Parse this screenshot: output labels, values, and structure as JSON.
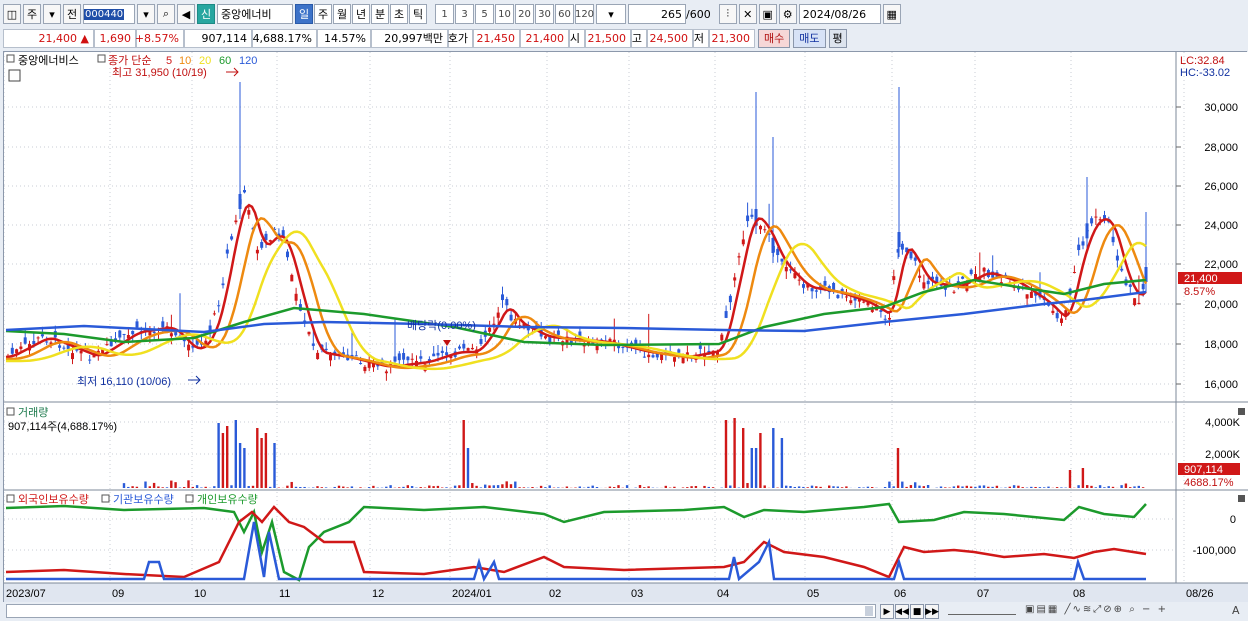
{
  "toolbar": {
    "market_label": "주",
    "prev_label": "전",
    "stock_code": "000440",
    "new_badge": "신",
    "stock_name": "중앙에너비",
    "periods": [
      "일",
      "주",
      "월",
      "년",
      "분",
      "초",
      "틱"
    ],
    "active_period": "일",
    "interval_numbers": [
      "1",
      "3",
      "5",
      "10",
      "20",
      "30",
      "60",
      "120"
    ],
    "count": "265",
    "count_total": "/600",
    "date": "2024/08/26"
  },
  "quote": {
    "price": "21,400",
    "change": "1,690",
    "change_pct": "+8.57%",
    "volume": "907,114",
    "volume_pct": "4,688.17%",
    "turnover": "14.57%",
    "amount": "20,997백만",
    "ask_label": "호가",
    "ask": "21,450",
    "bid": "21,400",
    "open_label": "시",
    "open": "21,500",
    "high_label": "고",
    "high": "24,500",
    "low_label": "저",
    "low": "21,300",
    "buy_label": "매수",
    "sell_label": "매도",
    "avg_label": "평"
  },
  "price_panel": {
    "stock_name": "중앙에너비스",
    "ma_label": "종가 단순",
    "ma_periods": [
      "5",
      "10",
      "20",
      "60",
      "120"
    ],
    "ma_colors": [
      "#d01818",
      "#ee8a10",
      "#f0e020",
      "#1c9a2c",
      "#2a5ad8"
    ],
    "high_note": "최고 31,950 (10/19)",
    "low_note": "최저 16,110 (10/06)",
    "dividend_note": "배당락(0.00%)",
    "lc": "LC:32.84",
    "hc": "HC:-33.02",
    "y_ticks": [
      "30,000",
      "28,000",
      "26,000",
      "24,000",
      "22,000",
      "20,000",
      "18,000",
      "16,000"
    ],
    "last_price": "21,400",
    "last_pct": "8.57%"
  },
  "volume_panel": {
    "title": "거래량",
    "value": "907,114주(4,688.17%)",
    "y_ticks": [
      "4,000K",
      "2,000K"
    ],
    "last": "907,114",
    "last_pct": "4688.17%"
  },
  "holding_panel": {
    "titles": [
      "외국인보유수량",
      "기관보유수량",
      "개인보유수량"
    ],
    "colors": [
      "#d01818",
      "#2a5ad8",
      "#1c9a2c"
    ],
    "y_ticks": [
      "0",
      "-100,000"
    ]
  },
  "x_axis": [
    "2023/07",
    "09",
    "10",
    "11",
    "12",
    "2024/01",
    "02",
    "03",
    "04",
    "05",
    "06",
    "07",
    "08",
    "08/26"
  ],
  "colors": {
    "up": "#d01818",
    "down": "#2a5ad8",
    "grid": "#c8ccd6",
    "accent": "#3c72c8"
  }
}
